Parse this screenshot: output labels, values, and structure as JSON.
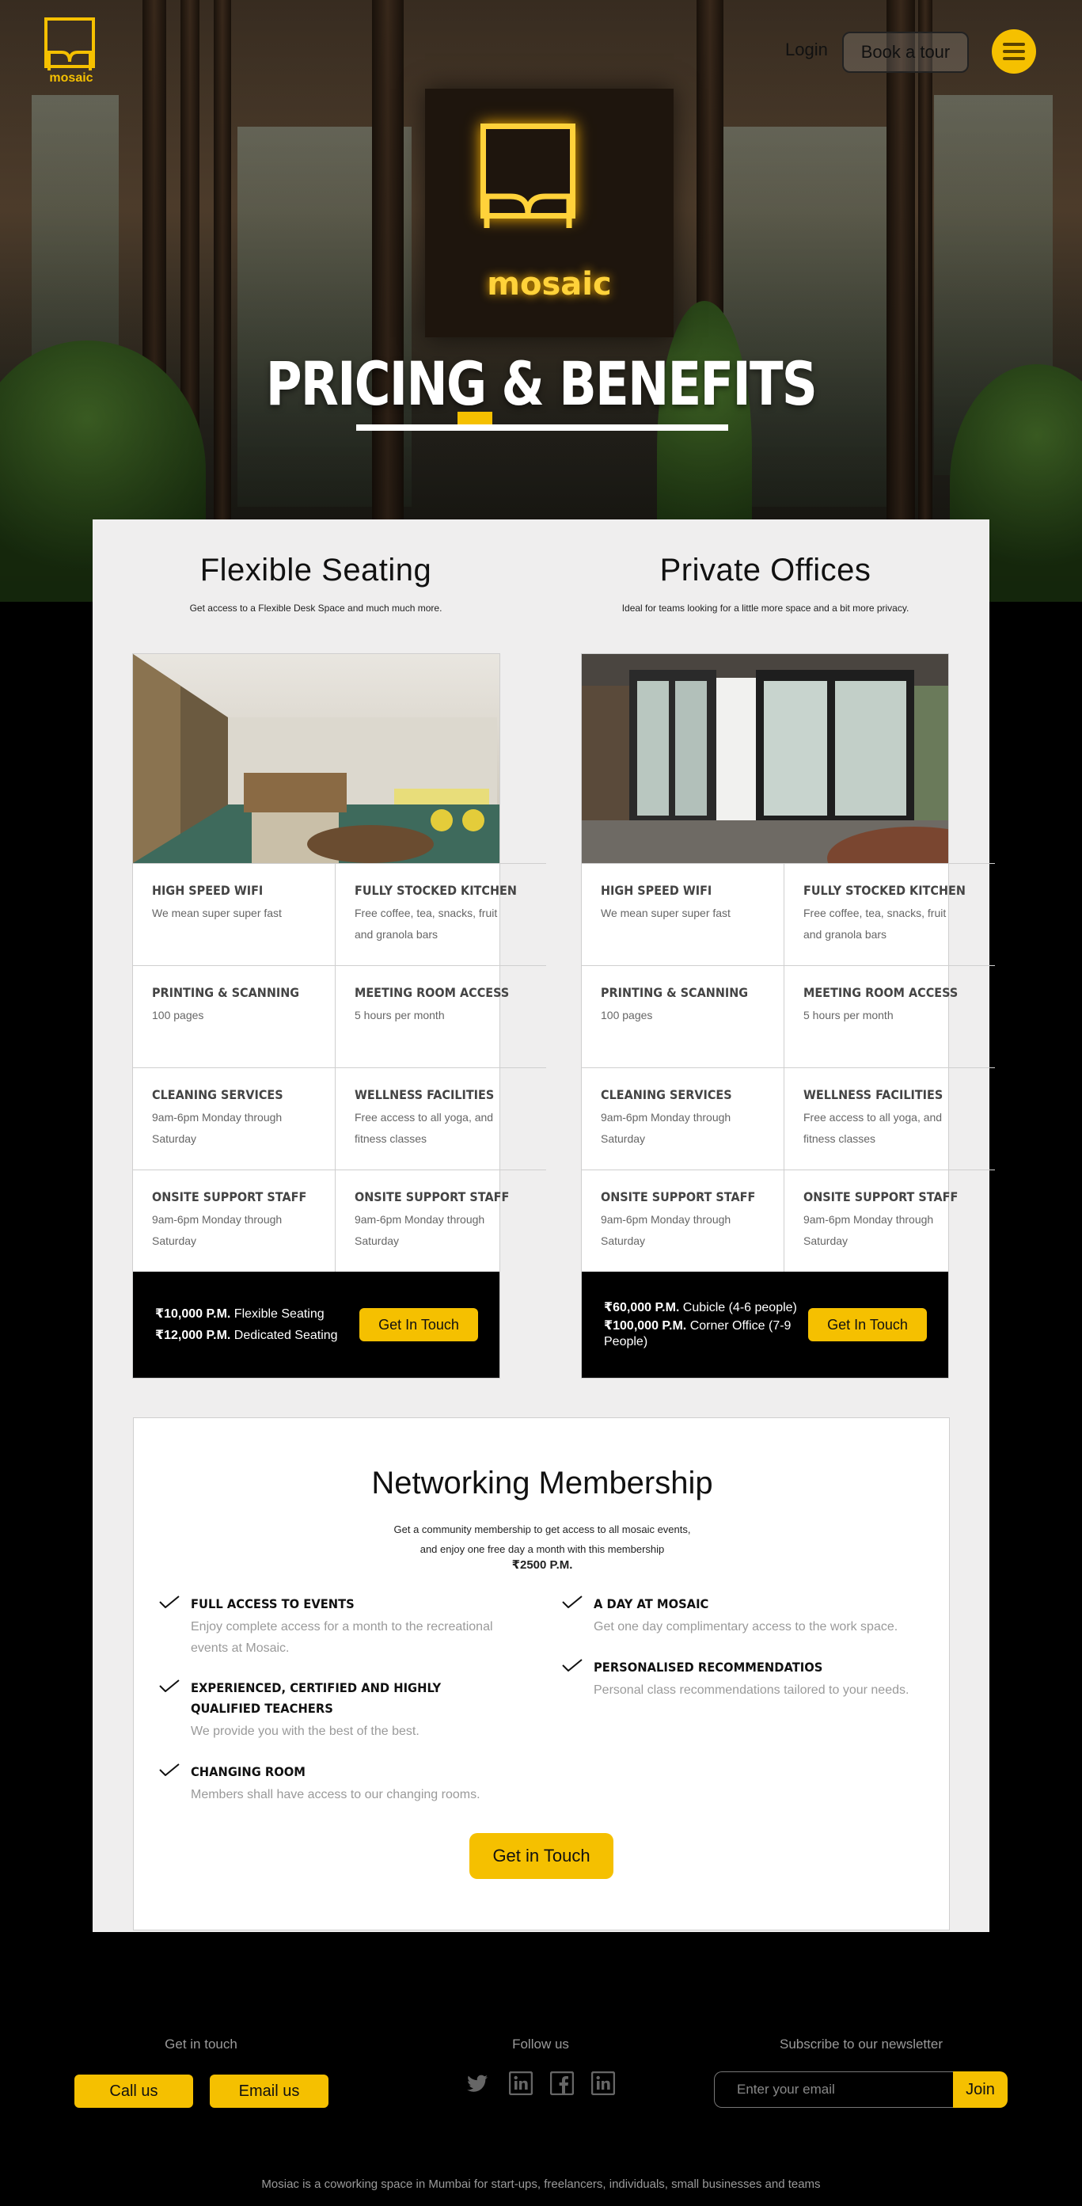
{
  "brand": {
    "name": "mosaic",
    "accent": "#f5c000"
  },
  "nav": {
    "login": "Login",
    "book_tour": "Book a tour",
    "menu_icon": "hamburger-icon"
  },
  "hero": {
    "title": "PRICING & BENEFITS",
    "sign_word": "mosaic"
  },
  "plans": [
    {
      "title": "Flexible Seating",
      "subtitle": "Get access to a Flexible Desk Space and much much more.",
      "features": [
        {
          "title": "HIGH SPEED WIFI",
          "desc": "We mean super super fast"
        },
        {
          "title": "FULLY STOCKED KITCHEN",
          "desc": "Free coffee, tea, snacks, fruit and granola bars"
        },
        {
          "title": "PRINTING & SCANNING",
          "desc": "100 pages"
        },
        {
          "title": "MEETING ROOM ACCESS",
          "desc": "5 hours per month"
        },
        {
          "title": "CLEANING SERVICES",
          "desc": "9am-6pm Monday through Saturday"
        },
        {
          "title": "WELLNESS FACILITIES",
          "desc": "Free access to all yoga, and fitness classes"
        },
        {
          "title": "ONSITE SUPPORT  STAFF",
          "desc": "9am-6pm Monday through Saturday"
        },
        {
          "title": "ONSITE SUPPORT  STAFF",
          "desc": "9am-6pm Monday through Saturday"
        }
      ],
      "prices": [
        {
          "amount": "₹10,000 P.M.",
          "label": "Flexible Seating"
        },
        {
          "amount": "₹12,000 P.M.",
          "label": "Dedicated Seating"
        }
      ],
      "cta": "Get In Touch"
    },
    {
      "title": "Private Offices",
      "subtitle": "Ideal for teams looking for a little more space and a bit more privacy.",
      "features": [
        {
          "title": "HIGH SPEED WIFI",
          "desc": "We mean super super fast"
        },
        {
          "title": "FULLY STOCKED KITCHEN",
          "desc": "Free coffee, tea, snacks, fruit and granola bars"
        },
        {
          "title": "PRINTING & SCANNING",
          "desc": "100 pages"
        },
        {
          "title": "MEETING ROOM ACCESS",
          "desc": "5 hours per month"
        },
        {
          "title": "CLEANING SERVICES",
          "desc": "9am-6pm Monday through Saturday"
        },
        {
          "title": "WELLNESS FACILITIES",
          "desc": "Free access to all yoga, and fitness classes"
        },
        {
          "title": "ONSITE SUPPORT  STAFF",
          "desc": "9am-6pm Monday through Saturday"
        },
        {
          "title": "ONSITE SUPPORT  STAFF",
          "desc": "9am-6pm Monday through Saturday"
        }
      ],
      "prices": [
        {
          "amount": "₹60,000 P.M.",
          "label": "Cubicle (4-6 people)"
        },
        {
          "amount": "₹100,000 P.M.",
          "label": "Corner Office (7-9 People)"
        }
      ],
      "cta": "Get In Touch"
    }
  ],
  "networking": {
    "title": "Networking Membership",
    "desc_1": "Get a community membership to get access to all mosaic events,",
    "desc_2": "and enjoy one free day a month with this membership",
    "fee": "₹2500 P.M.",
    "features_left": [
      {
        "title": "FULL ACCESS TO EVENTS",
        "desc": "Enjoy complete access for a month to the recreational events at Mosaic."
      },
      {
        "title": "EXPERIENCED, CERTIFIED AND HIGHLY QUALIFIED TEACHERS",
        "desc": "We provide you with the best of the best."
      },
      {
        "title": "CHANGING ROOM",
        "desc": "Members shall have access to our changing rooms."
      }
    ],
    "features_right": [
      {
        "title": "A DAY AT MOSAIC",
        "desc": "Get one day complimentary access to the work space."
      },
      {
        "title": "PERSONALISED RECOMMENDATIOS",
        "desc": "Personal class recommendations tailored to your needs."
      }
    ],
    "cta": "Get in Touch"
  },
  "footer": {
    "contact_label": "Get in touch",
    "call": "Call us",
    "email": "Email us",
    "follow_label": "Follow us",
    "socials": [
      "twitter-icon",
      "linkedin-icon",
      "facebook-icon",
      "linkedin-icon"
    ],
    "newsletter_label": "Subscribe to our newsletter",
    "newsletter_placeholder": "Enter your email",
    "join": "Join",
    "note": "Mosiac is a coworking space in Mumbai for start-ups, freelancers, individuals, small businesses and teams"
  }
}
